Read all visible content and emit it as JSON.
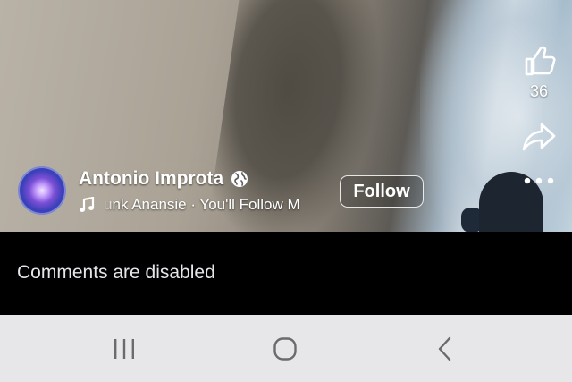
{
  "video": {
    "like_count": "36"
  },
  "author": {
    "name": "Antonio Improta",
    "follow_label": "Follow"
  },
  "music": {
    "text": "unk Anansie · You'll Follow M"
  },
  "comments": {
    "disabled_text": "Comments are disabled"
  },
  "icons": {
    "like": "thumbs-up-icon",
    "share": "share-arrow-icon",
    "more": "more-dots-icon",
    "globe": "globe-icon",
    "music": "music-note-icon",
    "nav_recents": "recent-apps-icon",
    "nav_home": "home-icon",
    "nav_back": "back-icon"
  },
  "colors": {
    "comments_background": "#000000",
    "nav_background": "#e7e7ea",
    "text_on_video": "#ffffff"
  }
}
